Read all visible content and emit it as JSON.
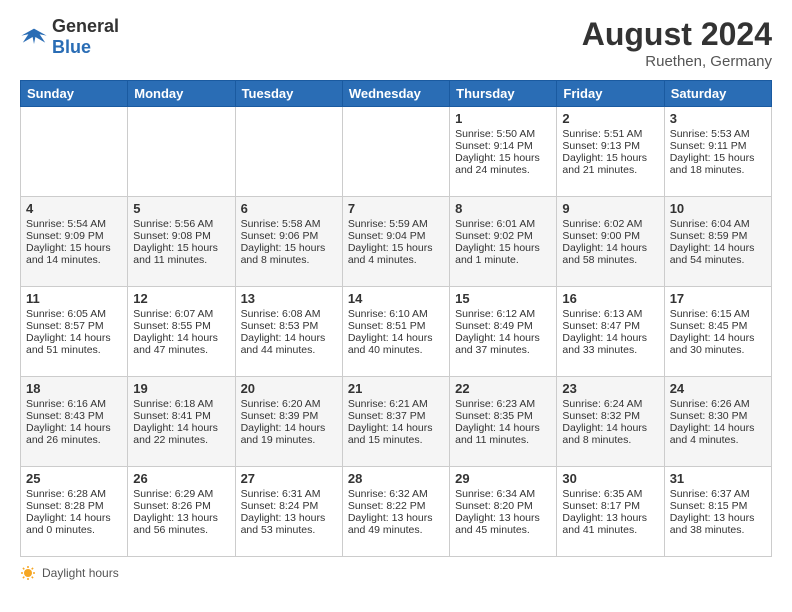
{
  "header": {
    "logo_general": "General",
    "logo_blue": "Blue",
    "month_year": "August 2024",
    "location": "Ruethen, Germany"
  },
  "days_of_week": [
    "Sunday",
    "Monday",
    "Tuesday",
    "Wednesday",
    "Thursday",
    "Friday",
    "Saturday"
  ],
  "weeks": [
    [
      {
        "day": "",
        "empty": true
      },
      {
        "day": "",
        "empty": true
      },
      {
        "day": "",
        "empty": true
      },
      {
        "day": "",
        "empty": true
      },
      {
        "day": "1",
        "sunrise": "Sunrise: 5:50 AM",
        "sunset": "Sunset: 9:14 PM",
        "daylight": "Daylight: 15 hours and 24 minutes."
      },
      {
        "day": "2",
        "sunrise": "Sunrise: 5:51 AM",
        "sunset": "Sunset: 9:13 PM",
        "daylight": "Daylight: 15 hours and 21 minutes."
      },
      {
        "day": "3",
        "sunrise": "Sunrise: 5:53 AM",
        "sunset": "Sunset: 9:11 PM",
        "daylight": "Daylight: 15 hours and 18 minutes."
      }
    ],
    [
      {
        "day": "4",
        "sunrise": "Sunrise: 5:54 AM",
        "sunset": "Sunset: 9:09 PM",
        "daylight": "Daylight: 15 hours and 14 minutes."
      },
      {
        "day": "5",
        "sunrise": "Sunrise: 5:56 AM",
        "sunset": "Sunset: 9:08 PM",
        "daylight": "Daylight: 15 hours and 11 minutes."
      },
      {
        "day": "6",
        "sunrise": "Sunrise: 5:58 AM",
        "sunset": "Sunset: 9:06 PM",
        "daylight": "Daylight: 15 hours and 8 minutes."
      },
      {
        "day": "7",
        "sunrise": "Sunrise: 5:59 AM",
        "sunset": "Sunset: 9:04 PM",
        "daylight": "Daylight: 15 hours and 4 minutes."
      },
      {
        "day": "8",
        "sunrise": "Sunrise: 6:01 AM",
        "sunset": "Sunset: 9:02 PM",
        "daylight": "Daylight: 15 hours and 1 minute."
      },
      {
        "day": "9",
        "sunrise": "Sunrise: 6:02 AM",
        "sunset": "Sunset: 9:00 PM",
        "daylight": "Daylight: 14 hours and 58 minutes."
      },
      {
        "day": "10",
        "sunrise": "Sunrise: 6:04 AM",
        "sunset": "Sunset: 8:59 PM",
        "daylight": "Daylight: 14 hours and 54 minutes."
      }
    ],
    [
      {
        "day": "11",
        "sunrise": "Sunrise: 6:05 AM",
        "sunset": "Sunset: 8:57 PM",
        "daylight": "Daylight: 14 hours and 51 minutes."
      },
      {
        "day": "12",
        "sunrise": "Sunrise: 6:07 AM",
        "sunset": "Sunset: 8:55 PM",
        "daylight": "Daylight: 14 hours and 47 minutes."
      },
      {
        "day": "13",
        "sunrise": "Sunrise: 6:08 AM",
        "sunset": "Sunset: 8:53 PM",
        "daylight": "Daylight: 14 hours and 44 minutes."
      },
      {
        "day": "14",
        "sunrise": "Sunrise: 6:10 AM",
        "sunset": "Sunset: 8:51 PM",
        "daylight": "Daylight: 14 hours and 40 minutes."
      },
      {
        "day": "15",
        "sunrise": "Sunrise: 6:12 AM",
        "sunset": "Sunset: 8:49 PM",
        "daylight": "Daylight: 14 hours and 37 minutes."
      },
      {
        "day": "16",
        "sunrise": "Sunrise: 6:13 AM",
        "sunset": "Sunset: 8:47 PM",
        "daylight": "Daylight: 14 hours and 33 minutes."
      },
      {
        "day": "17",
        "sunrise": "Sunrise: 6:15 AM",
        "sunset": "Sunset: 8:45 PM",
        "daylight": "Daylight: 14 hours and 30 minutes."
      }
    ],
    [
      {
        "day": "18",
        "sunrise": "Sunrise: 6:16 AM",
        "sunset": "Sunset: 8:43 PM",
        "daylight": "Daylight: 14 hours and 26 minutes."
      },
      {
        "day": "19",
        "sunrise": "Sunrise: 6:18 AM",
        "sunset": "Sunset: 8:41 PM",
        "daylight": "Daylight: 14 hours and 22 minutes."
      },
      {
        "day": "20",
        "sunrise": "Sunrise: 6:20 AM",
        "sunset": "Sunset: 8:39 PM",
        "daylight": "Daylight: 14 hours and 19 minutes."
      },
      {
        "day": "21",
        "sunrise": "Sunrise: 6:21 AM",
        "sunset": "Sunset: 8:37 PM",
        "daylight": "Daylight: 14 hours and 15 minutes."
      },
      {
        "day": "22",
        "sunrise": "Sunrise: 6:23 AM",
        "sunset": "Sunset: 8:35 PM",
        "daylight": "Daylight: 14 hours and 11 minutes."
      },
      {
        "day": "23",
        "sunrise": "Sunrise: 6:24 AM",
        "sunset": "Sunset: 8:32 PM",
        "daylight": "Daylight: 14 hours and 8 minutes."
      },
      {
        "day": "24",
        "sunrise": "Sunrise: 6:26 AM",
        "sunset": "Sunset: 8:30 PM",
        "daylight": "Daylight: 14 hours and 4 minutes."
      }
    ],
    [
      {
        "day": "25",
        "sunrise": "Sunrise: 6:28 AM",
        "sunset": "Sunset: 8:28 PM",
        "daylight": "Daylight: 14 hours and 0 minutes."
      },
      {
        "day": "26",
        "sunrise": "Sunrise: 6:29 AM",
        "sunset": "Sunset: 8:26 PM",
        "daylight": "Daylight: 13 hours and 56 minutes."
      },
      {
        "day": "27",
        "sunrise": "Sunrise: 6:31 AM",
        "sunset": "Sunset: 8:24 PM",
        "daylight": "Daylight: 13 hours and 53 minutes."
      },
      {
        "day": "28",
        "sunrise": "Sunrise: 6:32 AM",
        "sunset": "Sunset: 8:22 PM",
        "daylight": "Daylight: 13 hours and 49 minutes."
      },
      {
        "day": "29",
        "sunrise": "Sunrise: 6:34 AM",
        "sunset": "Sunset: 8:20 PM",
        "daylight": "Daylight: 13 hours and 45 minutes."
      },
      {
        "day": "30",
        "sunrise": "Sunrise: 6:35 AM",
        "sunset": "Sunset: 8:17 PM",
        "daylight": "Daylight: 13 hours and 41 minutes."
      },
      {
        "day": "31",
        "sunrise": "Sunrise: 6:37 AM",
        "sunset": "Sunset: 8:15 PM",
        "daylight": "Daylight: 13 hours and 38 minutes."
      }
    ]
  ],
  "footer": {
    "daylight_label": "Daylight hours"
  }
}
